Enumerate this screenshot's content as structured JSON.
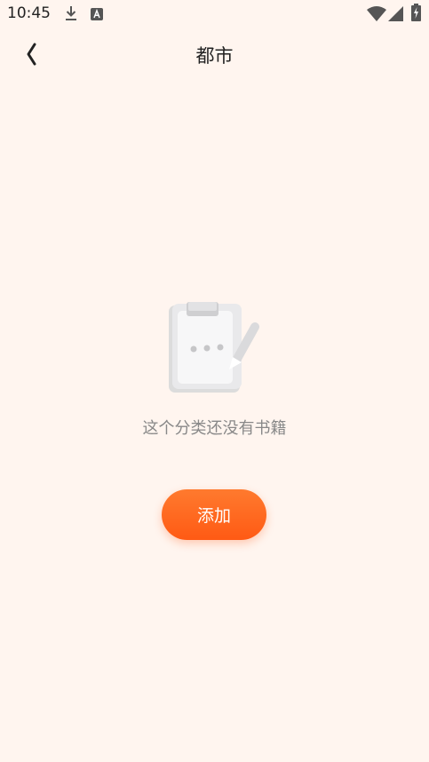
{
  "status_bar": {
    "time": "10:45",
    "icons": [
      "download-icon",
      "a-badge-icon",
      "wifi-icon",
      "signal-icon",
      "battery-charging-icon"
    ]
  },
  "header": {
    "back_icon": "chevron-left-icon",
    "title": "都市"
  },
  "empty_state": {
    "illustration": "notepad-pencil-icon",
    "message": "这个分类还没有书籍"
  },
  "actions": {
    "add_label": "添加"
  },
  "colors": {
    "background": "#fff5ef",
    "accent": "#ff5a14",
    "text_primary": "#222222",
    "text_secondary": "#888888"
  }
}
